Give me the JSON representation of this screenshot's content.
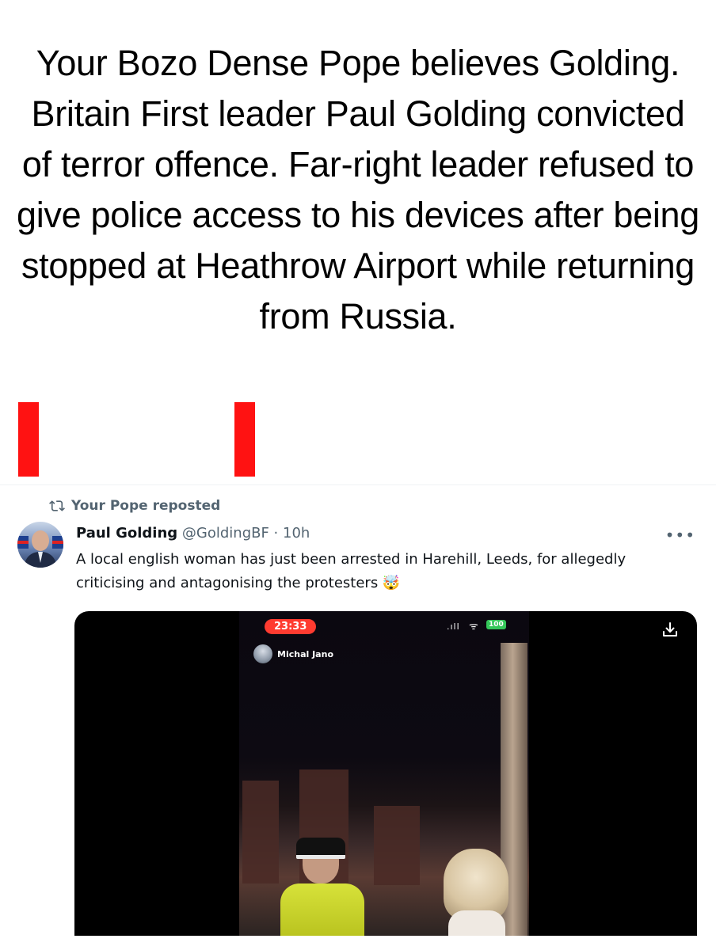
{
  "headline": "Your Bozo Dense Pope believes Golding. Britain First leader Paul Golding convicted of terror offence. Far-right leader refused to give police access to his devices after being stopped at Heathrow Airport while returning from Russia.",
  "annotation_color": "#ff1212",
  "tweet": {
    "repost_label": "Your Pope reposted",
    "author_name": "Paul Golding",
    "meta": "@GoldingBF · 10h",
    "text": "A local english woman has just been arrested in Harehill, Leeds, for allegedly criticising and antagonising the protesters 🤯",
    "more_icon": "more-dots-icon",
    "media": {
      "video_time": "23:33",
      "signal": ".ıll",
      "wifi": "ᯤ",
      "battery": "100",
      "uploader_name": "Michal Jano",
      "download_icon": "download-icon"
    }
  }
}
